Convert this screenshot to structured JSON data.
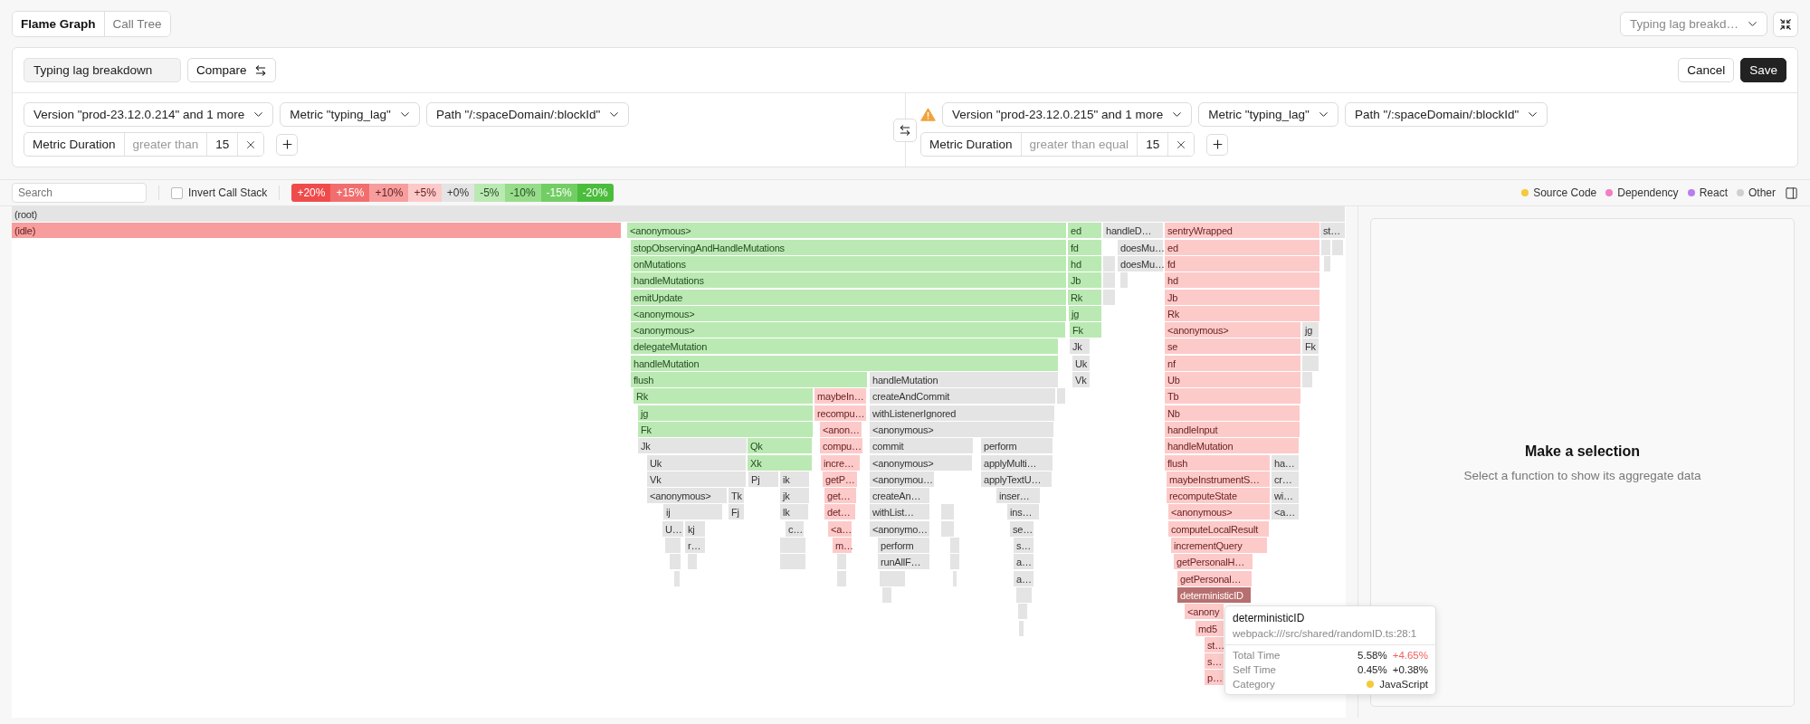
{
  "view_tabs": [
    {
      "label": "Flame Graph",
      "selected": true
    },
    {
      "label": "Call Tree",
      "selected": false
    }
  ],
  "saved_view": {
    "value": "Typing lag breakd…"
  },
  "editor": {
    "name": "Typing lag breakdown",
    "compare_label": "Compare",
    "cancel": "Cancel",
    "save": "Save"
  },
  "comparison": [
    {
      "warning": false,
      "filters": [
        "Version \"prod-23.12.0.214\" and 1 more",
        "Metric \"typing_lag\"",
        "Path \"/:spaceDomain/:blockId\""
      ],
      "condition": {
        "field": "Metric Duration",
        "operator": "greater than",
        "value": "15"
      }
    },
    {
      "warning": true,
      "filters": [
        "Version \"prod-23.12.0.215\" and 1 more",
        "Metric \"typing_lag\"",
        "Path \"/:spaceDomain/:blockId\""
      ],
      "condition": {
        "field": "Metric Duration",
        "operator": "greater than equal",
        "value": "15"
      }
    }
  ],
  "toolbar": {
    "search_placeholder": "Search",
    "invert": {
      "label": "Invert Call Stack",
      "checked": false
    },
    "scale": [
      {
        "label": "+20%",
        "color": "#ef4b4b"
      },
      {
        "label": "+15%",
        "color": "#f26e6e"
      },
      {
        "label": "+10%",
        "color": "#f89d9d"
      },
      {
        "label": "+5%",
        "color": "#fdcaca"
      },
      {
        "label": "+0%",
        "color": "#e4e4e4"
      },
      {
        "label": "-5%",
        "color": "#bbe9b3"
      },
      {
        "label": "-10%",
        "color": "#97dc8b"
      },
      {
        "label": "-15%",
        "color": "#72ce64"
      },
      {
        "label": "-20%",
        "color": "#4bbd3c"
      }
    ]
  },
  "categories": [
    {
      "label": "Source Code",
      "color": "#f5c93a"
    },
    {
      "label": "Dependency",
      "color": "#f27ec4"
    },
    {
      "label": "React",
      "color": "#b87ef0"
    },
    {
      "label": "Other",
      "color": "#cfcfcf"
    }
  ],
  "flame": {
    "frames": [
      {
        "label": "(root)",
        "color": "#e4e4e4"
      },
      {
        "label": "(idle)",
        "color": "#f89d9d"
      },
      {
        "label": "<anonymous>",
        "color": "#bbe9b3"
      },
      {
        "label": "ed",
        "color": "#bbe9b3"
      },
      {
        "label": "handleD…",
        "color": "#e4e4e4"
      },
      {
        "label": "sentryWrapped",
        "color": "#fdcaca"
      },
      {
        "label": "st…",
        "color": "#e4e4e4"
      },
      {
        "label": "stopObservingAndHandleMutations",
        "color": "#bbe9b3"
      },
      {
        "label": "fd",
        "color": "#bbe9b3"
      },
      {
        "label": "doesMu…",
        "color": "#e4e4e4"
      },
      {
        "label": "ed",
        "color": "#fdcaca"
      },
      {
        "label": "onMutations",
        "color": "#bbe9b3"
      },
      {
        "label": "hd",
        "color": "#bbe9b3"
      },
      {
        "label": "doesMu…",
        "color": "#e4e4e4"
      },
      {
        "label": "fd",
        "color": "#fdcaca"
      },
      {
        "label": "handleMutations",
        "color": "#bbe9b3"
      },
      {
        "label": "Jb",
        "color": "#bbe9b3"
      },
      {
        "label": "hd",
        "color": "#fdcaca"
      },
      {
        "label": "emitUpdate",
        "color": "#bbe9b3"
      },
      {
        "label": "Rk",
        "color": "#bbe9b3"
      },
      {
        "label": "Jb",
        "color": "#fdcaca"
      },
      {
        "label": "<anonymous>",
        "color": "#bbe9b3"
      },
      {
        "label": "jg",
        "color": "#bbe9b3"
      },
      {
        "label": "Rk",
        "color": "#fdcaca"
      },
      {
        "label": "<anonymous>",
        "color": "#bbe9b3"
      },
      {
        "label": "Fk",
        "color": "#bbe9b3"
      },
      {
        "label": "<anonymous>",
        "color": "#fdcaca"
      },
      {
        "label": "jg",
        "color": "#e4e4e4"
      },
      {
        "label": "delegateMutation",
        "color": "#bbe9b3"
      },
      {
        "label": "Jk",
        "color": "#e4e4e4"
      },
      {
        "label": "se",
        "color": "#fdcaca"
      },
      {
        "label": "Fk",
        "color": "#e4e4e4"
      },
      {
        "label": "handleMutation",
        "color": "#bbe9b3"
      },
      {
        "label": "Uk",
        "color": "#e4e4e4"
      },
      {
        "label": "nf",
        "color": "#fdcaca"
      },
      {
        "label": "flush",
        "color": "#bbe9b3"
      },
      {
        "label": "handleMutation",
        "color": "#e4e4e4"
      },
      {
        "label": "Vk",
        "color": "#e4e4e4"
      },
      {
        "label": "Ub",
        "color": "#fdcaca"
      },
      {
        "label": "Rk",
        "color": "#bbe9b3"
      },
      {
        "label": "maybeIn…",
        "color": "#fdcaca"
      },
      {
        "label": "createAndCommit",
        "color": "#e4e4e4"
      },
      {
        "label": "Tb",
        "color": "#fdcaca"
      },
      {
        "label": "jg",
        "color": "#bbe9b3"
      },
      {
        "label": "recompu…",
        "color": "#fdcaca"
      },
      {
        "label": "withListenerIgnored",
        "color": "#e4e4e4"
      },
      {
        "label": "Nb",
        "color": "#fdcaca"
      },
      {
        "label": "Fk",
        "color": "#bbe9b3"
      },
      {
        "label": "<anon…",
        "color": "#fdcaca"
      },
      {
        "label": "<anonymous>",
        "color": "#e4e4e4"
      },
      {
        "label": "handleInput",
        "color": "#fdcaca"
      },
      {
        "label": "Jk",
        "color": "#e4e4e4"
      },
      {
        "label": "Qk",
        "color": "#bbe9b3"
      },
      {
        "label": "compu…",
        "color": "#fdcaca"
      },
      {
        "label": "commit",
        "color": "#e4e4e4"
      },
      {
        "label": "perform",
        "color": "#e4e4e4"
      },
      {
        "label": "handleMutation",
        "color": "#fdcaca"
      },
      {
        "label": "Uk",
        "color": "#e4e4e4"
      },
      {
        "label": "Xk",
        "color": "#bbe9b3"
      },
      {
        "label": "incre…",
        "color": "#fdcaca"
      },
      {
        "label": "<anonymous>",
        "color": "#e4e4e4"
      },
      {
        "label": "applyMulti…",
        "color": "#e4e4e4"
      },
      {
        "label": "flush",
        "color": "#fdcaca"
      },
      {
        "label": "ha…",
        "color": "#e4e4e4"
      },
      {
        "label": "Vk",
        "color": "#e4e4e4"
      },
      {
        "label": "Pj",
        "color": "#e4e4e4"
      },
      {
        "label": "ik",
        "color": "#e4e4e4"
      },
      {
        "label": "getP…",
        "color": "#fdcaca"
      },
      {
        "label": "<anonymou…",
        "color": "#e4e4e4"
      },
      {
        "label": "applyTextU…",
        "color": "#e4e4e4"
      },
      {
        "label": "maybeInstrumentS…",
        "color": "#fdcaca"
      },
      {
        "label": "cr…",
        "color": "#e4e4e4"
      },
      {
        "label": "<anonymous>",
        "color": "#e4e4e4"
      },
      {
        "label": "Tk",
        "color": "#e4e4e4"
      },
      {
        "label": "jk",
        "color": "#e4e4e4"
      },
      {
        "label": "get…",
        "color": "#fdcaca"
      },
      {
        "label": "createAn…",
        "color": "#e4e4e4"
      },
      {
        "label": "inser…",
        "color": "#e4e4e4"
      },
      {
        "label": "recomputeState",
        "color": "#fdcaca"
      },
      {
        "label": "wi…",
        "color": "#e4e4e4"
      },
      {
        "label": "ij",
        "color": "#e4e4e4"
      },
      {
        "label": "Fj",
        "color": "#e4e4e4"
      },
      {
        "label": "lk",
        "color": "#e4e4e4"
      },
      {
        "label": "det…",
        "color": "#fdcaca"
      },
      {
        "label": "withList…",
        "color": "#e4e4e4"
      },
      {
        "label": "ins…",
        "color": "#e4e4e4"
      },
      {
        "label": "<anonymous>",
        "color": "#fdcaca"
      },
      {
        "label": "<a…",
        "color": "#e4e4e4"
      },
      {
        "label": "U…",
        "color": "#e4e4e4"
      },
      {
        "label": "kj",
        "color": "#e4e4e4"
      },
      {
        "label": "c…",
        "color": "#e4e4e4"
      },
      {
        "label": "<a…",
        "color": "#fdcaca"
      },
      {
        "label": "<anonymo…",
        "color": "#e4e4e4"
      },
      {
        "label": "se…",
        "color": "#e4e4e4"
      },
      {
        "label": "computeLocalResult",
        "color": "#fdcaca"
      },
      {
        "label": "r…",
        "color": "#e4e4e4"
      },
      {
        "label": "m…",
        "color": "#fdcaca"
      },
      {
        "label": "perform",
        "color": "#e4e4e4"
      },
      {
        "label": "s…",
        "color": "#e4e4e4"
      },
      {
        "label": "incrementQuery",
        "color": "#fdcaca"
      },
      {
        "label": "runAllF…",
        "color": "#e4e4e4"
      },
      {
        "label": "a…",
        "color": "#e4e4e4"
      },
      {
        "label": "getPersonalH…",
        "color": "#fdcaca"
      },
      {
        "label": "a…",
        "color": "#e4e4e4"
      },
      {
        "label": "getPersonal…",
        "color": "#fdcaca"
      },
      {
        "label": "deterministicID",
        "color": "#b86f6f"
      },
      {
        "label": "<anony",
        "color": "#fdcaca"
      },
      {
        "label": "md5",
        "color": "#fdcaca"
      },
      {
        "label": "st…",
        "color": "#fdcaca"
      },
      {
        "label": "s…",
        "color": "#fdcaca"
      },
      {
        "label": "p…",
        "color": "#fdcaca"
      },
      {
        "color": "#e4e4e4"
      },
      {
        "color": "#e4e4e4"
      },
      {
        "color": "#e4e4e4"
      },
      {
        "color": "#e4e4e4"
      },
      {
        "color": "#e4e4e4"
      },
      {
        "color": "#e4e4e4"
      },
      {
        "color": "#e4e4e4"
      },
      {
        "color": "#e4e4e4"
      },
      {
        "color": "#e4e4e4"
      },
      {
        "color": "#e4e4e4"
      },
      {
        "color": "#e4e4e4"
      },
      {
        "color": "#e4e4e4"
      },
      {
        "color": "#e4e4e4"
      },
      {
        "color": "#e4e4e4"
      },
      {
        "color": "#e4e4e4"
      },
      {
        "color": "#e4e4e4"
      },
      {
        "color": "#e4e4e4"
      },
      {
        "color": "#e4e4e4"
      },
      {
        "color": "#e4e4e4"
      },
      {
        "color": "#e4e4e4"
      },
      {
        "color": "#e4e4e4"
      },
      {
        "color": "#e4e4e4"
      },
      {
        "color": "#e4e4e4"
      },
      {
        "color": "#e4e4e4"
      },
      {
        "color": "#e4e4e4"
      },
      {
        "color": "#e4e4e4"
      },
      {
        "color": "#e4e4e4"
      },
      {
        "color": "#e4e4e4"
      }
    ]
  },
  "tooltip": {
    "title": "deterministicID",
    "source": "webpack:///src/shared/randomID.ts:28:1",
    "rows": [
      {
        "kind": "metric",
        "label": "Total Time",
        "value": "5.58%",
        "delta": "+4.65%",
        "delta_up": true
      },
      {
        "kind": "metric",
        "label": "Self Time",
        "value": "0.45%",
        "delta": "+0.38%",
        "delta_up": false
      },
      {
        "kind": "category",
        "label": "Category",
        "value": "JavaScript",
        "color": "#f5c93a"
      }
    ]
  },
  "details": {
    "title": "Make a selection",
    "hint": "Select a function to show its aggregate data"
  }
}
